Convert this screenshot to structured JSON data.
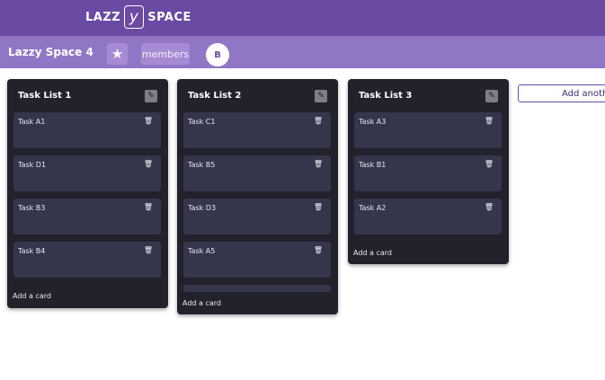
{
  "topbar": {
    "logo_left": "LAZZ",
    "logo_mark": "y",
    "logo_right": "SPACE"
  },
  "board": {
    "title": "Lazzy Space 4",
    "members_label": "members",
    "avatar_initial": "B",
    "star_icon": "★"
  },
  "lists": [
    {
      "title": "Task List 1",
      "cards": [
        "Task A1",
        "Task D1",
        "Task B3",
        "Task B4"
      ],
      "add_label": "Add a card"
    },
    {
      "title": "Task List 2",
      "cards": [
        "Task C1",
        "Task B5",
        "Task D3",
        "Task A5"
      ],
      "add_label": "Add a card"
    },
    {
      "title": "Task List 3",
      "cards": [
        "Task A3",
        "Task B1",
        "Task A2"
      ],
      "add_label": "Add a card"
    }
  ],
  "add_list_label": "Add another list"
}
